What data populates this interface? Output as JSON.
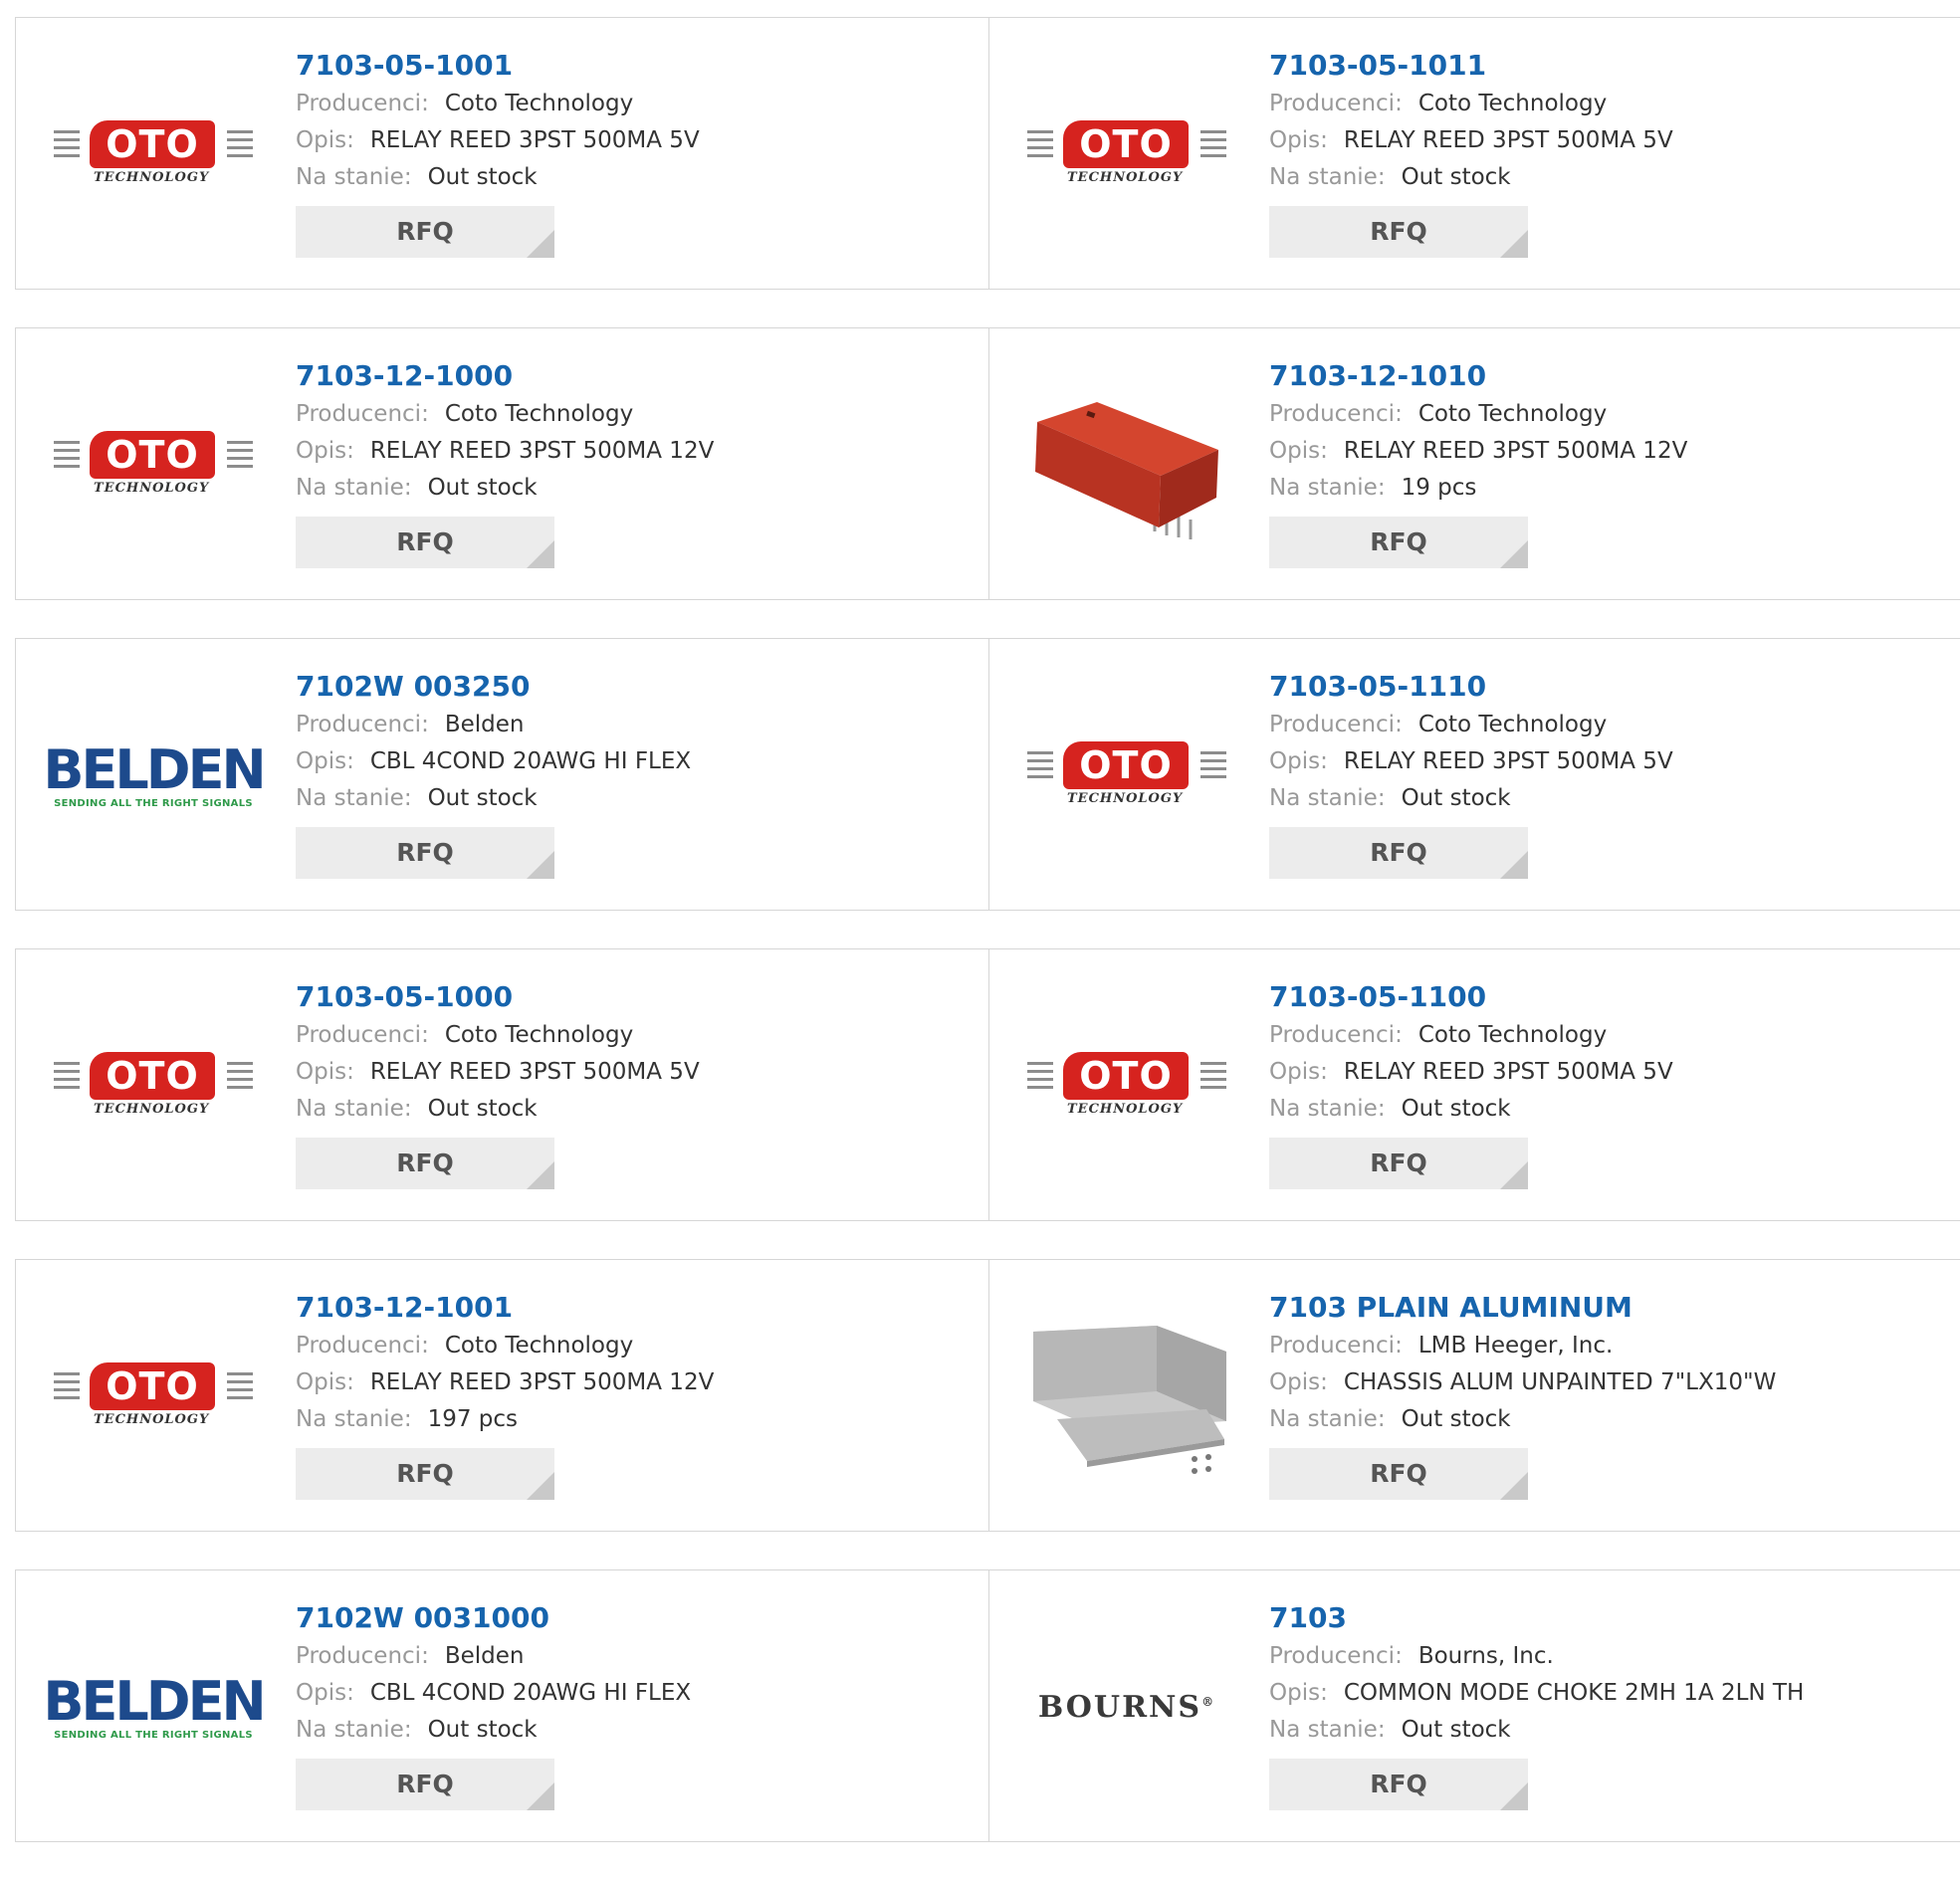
{
  "labels": {
    "manufacturer": "Producenci:",
    "description": "Opis:",
    "stock": "Na stanie:",
    "rfq": "RFQ"
  },
  "logos": {
    "coto": {
      "mark": "OTO",
      "sub": "TECHNOLOGY"
    },
    "belden": {
      "word": "BELDEN",
      "tag": "SENDING ALL THE RIGHT SIGNALS"
    },
    "bourns": {
      "word": "BOURNS"
    }
  },
  "products": [
    {
      "part": "7103-05-1001",
      "manufacturer": "Coto Technology",
      "description": "RELAY REED 3PST 500MA 5V",
      "stock": "Out stock",
      "image": "coto-logo"
    },
    {
      "part": "7103-05-1011",
      "manufacturer": "Coto Technology",
      "description": "RELAY REED 3PST 500MA 5V",
      "stock": "Out stock",
      "image": "coto-logo"
    },
    {
      "part": "7103-12-1000",
      "manufacturer": "Coto Technology",
      "description": "RELAY REED 3PST 500MA 12V",
      "stock": "Out stock",
      "image": "coto-logo"
    },
    {
      "part": "7103-12-1010",
      "manufacturer": "Coto Technology",
      "description": "RELAY REED 3PST 500MA 12V",
      "stock": "19 pcs",
      "image": "red-relay-photo"
    },
    {
      "part": "7102W 003250",
      "manufacturer": "Belden",
      "description": "CBL 4COND 20AWG HI FLEX",
      "stock": "Out stock",
      "image": "belden-logo"
    },
    {
      "part": "7103-05-1110",
      "manufacturer": "Coto Technology",
      "description": "RELAY REED 3PST 500MA 5V",
      "stock": "Out stock",
      "image": "coto-logo"
    },
    {
      "part": "7103-05-1000",
      "manufacturer": "Coto Technology",
      "description": "RELAY REED 3PST 500MA 5V",
      "stock": "Out stock",
      "image": "coto-logo"
    },
    {
      "part": "7103-05-1100",
      "manufacturer": "Coto Technology",
      "description": "RELAY REED 3PST 500MA 5V",
      "stock": "Out stock",
      "image": "coto-logo"
    },
    {
      "part": "7103-12-1001",
      "manufacturer": "Coto Technology",
      "description": "RELAY REED 3PST 500MA 12V",
      "stock": "197 pcs",
      "image": "coto-logo"
    },
    {
      "part": "7103 PLAIN ALUMINUM",
      "manufacturer": "LMB Heeger, Inc.",
      "description": "CHASSIS ALUM UNPAINTED 7\"LX10\"W",
      "stock": "Out stock",
      "image": "aluminum-chassis-photo"
    },
    {
      "part": "7102W 0031000",
      "manufacturer": "Belden",
      "description": "CBL 4COND 20AWG HI FLEX",
      "stock": "Out stock",
      "image": "belden-logo"
    },
    {
      "part": "7103",
      "manufacturer": "Bourns, Inc.",
      "description": "COMMON MODE CHOKE 2MH 1A 2LN TH",
      "stock": "Out stock",
      "image": "bourns-logo"
    }
  ]
}
